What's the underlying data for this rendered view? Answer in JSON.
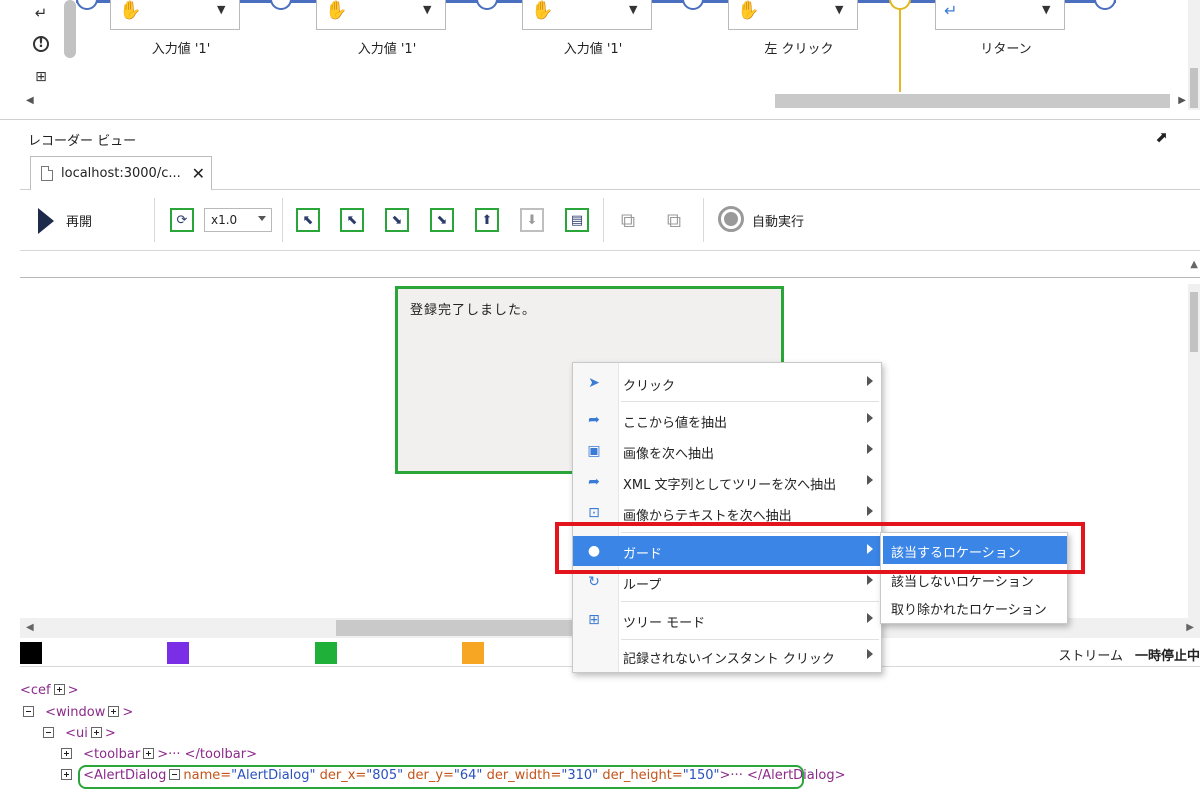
{
  "workflow": {
    "left_tools": [
      {
        "icon": "return-icon",
        "glyph": "↵"
      },
      {
        "icon": "alert-icon",
        "glyph": "⓵"
      },
      {
        "icon": "tree-icon",
        "glyph": "⊢"
      }
    ],
    "steps": [
      {
        "label": "入力値 '1'",
        "icon": "hand-icon"
      },
      {
        "label": "入力値 '1'",
        "icon": "hand-icon"
      },
      {
        "label": "入力値 '1'",
        "icon": "hand-icon"
      },
      {
        "label": "左 クリック",
        "icon": "hand-icon"
      },
      {
        "label": "リターン",
        "icon": "return-icon"
      }
    ]
  },
  "recorder": {
    "title": "レコーダー ビュー",
    "tab_label": "localhost:3000/c...",
    "toolbar": {
      "resume_label": "再開",
      "speed_value": "x1.0",
      "auto_run_label": "自動実行"
    }
  },
  "browser": {
    "alert_message": "登録完了しました。"
  },
  "colors": {
    "swatches": [
      "#000000",
      "#7a2ee6",
      "#1fb03a",
      "#f7a623"
    ],
    "accent": "#3b85e6",
    "highlight_green": "#2aa53a",
    "highlight_red": "#e3141b"
  },
  "status": {
    "stream_label": "ストリーム",
    "stream_state": "一時停止中"
  },
  "tree": {
    "row_cef": "<cef",
    "row_window": "<window",
    "row_ui": "<ui",
    "row_toolbar_open": "<toolbar",
    "row_toolbar_close": ">··· </toolbar>",
    "row_alert_open": "<AlertDialog",
    "attr_name": "name=",
    "val_name": "\"AlertDialog\"",
    "attr_x": "der_x=",
    "val_x": "\"805\"",
    "attr_y": "der_y=",
    "val_y": "\"64\"",
    "attr_w": "der_width=",
    "val_w": "\"310\"",
    "attr_h": "der_height=",
    "val_h": "\"150\"",
    "row_alert_close": ">··· </AlertDialog>",
    "gt": ">"
  },
  "context_menu": {
    "items": [
      {
        "label": "クリック",
        "icon": "cursor-icon"
      },
      {
        "label": "ここから値を抽出",
        "icon": "share-icon"
      },
      {
        "label": "画像を次へ抽出",
        "icon": "image-icon"
      },
      {
        "label": "XML 文字列としてツリーを次へ抽出",
        "icon": "share-icon"
      },
      {
        "label": "画像からテキストを次へ抽出",
        "icon": "ocr-icon"
      },
      {
        "label": "ガード",
        "icon": "guard-icon"
      },
      {
        "label": "ループ",
        "icon": "loop-icon"
      },
      {
        "label": "ツリー モード",
        "icon": "tree-icon"
      },
      {
        "label": "記録されないインスタント クリック",
        "icon": ""
      }
    ],
    "submenu": [
      {
        "label": "該当するロケーション"
      },
      {
        "label": "該当しないロケーション"
      },
      {
        "label": "取り除かれたロケーション"
      }
    ]
  }
}
